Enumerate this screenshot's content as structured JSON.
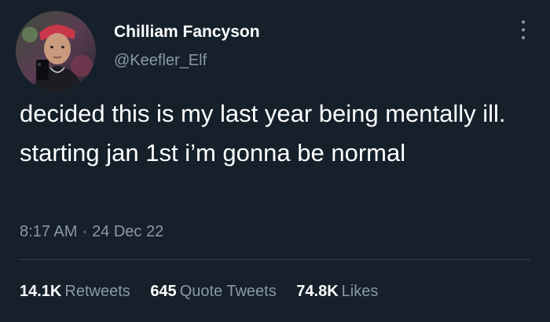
{
  "colors": {
    "background": "#15202b",
    "primary_text": "#ffffff",
    "secondary_text": "#8b98a5",
    "divider": "#38444d"
  },
  "author": {
    "display_name": "Chilliam Fancyson",
    "handle": "@Keefler_Elf",
    "avatar_icon": "profile-photo"
  },
  "tweet": {
    "text": "decided this is my last year being mentally ill. starting jan 1st i’m gonna be normal",
    "time": "8:17 AM",
    "separator": "·",
    "date": "24 Dec 22"
  },
  "stats": {
    "retweets": {
      "count": "14.1K",
      "label": "Retweets"
    },
    "quote_tweets": {
      "count": "645",
      "label": "Quote Tweets"
    },
    "likes": {
      "count": "74.8K",
      "label": "Likes"
    }
  }
}
